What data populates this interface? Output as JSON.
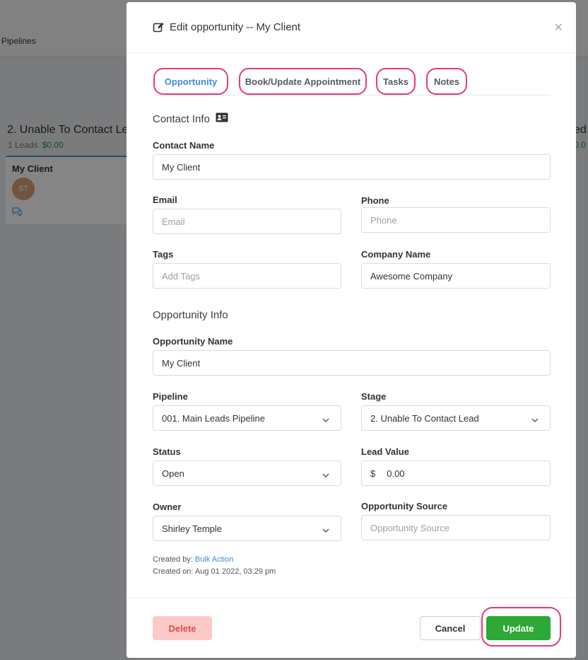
{
  "background": {
    "topbar_label": "Pipelines",
    "column_title": "2. Unable To Contact Le",
    "column_leads": "1 Leads",
    "column_amount": "$0.00",
    "card_name": "My Client",
    "card_avatar": "ST",
    "right_column_text": "ed",
    "right_column_sub": "0.0"
  },
  "modal": {
    "title": "Edit opportunity -- My Client",
    "title_icon": "edit-icon",
    "close_icon": "×",
    "tabs": [
      {
        "label": "Opportunity",
        "active": true
      },
      {
        "label": "Book/Update Appointment",
        "active": false
      },
      {
        "label": "Tasks",
        "active": false
      },
      {
        "label": "Notes",
        "active": false
      }
    ],
    "contact_info": {
      "section_title": "Contact Info",
      "contact_name_label": "Contact Name",
      "contact_name_value": "My Client",
      "email_label": "Email",
      "email_placeholder": "Email",
      "phone_label": "Phone",
      "phone_placeholder": "Phone",
      "tags_label": "Tags",
      "tags_placeholder": "Add Tags",
      "company_label": "Company Name",
      "company_value": "Awesome Company"
    },
    "opportunity_info": {
      "section_title": "Opportunity Info",
      "opportunity_name_label": "Opportunity Name",
      "opportunity_name_value": "My Client",
      "pipeline_label": "Pipeline",
      "pipeline_value": "001. Main Leads Pipeline",
      "stage_label": "Stage",
      "stage_value": "2. Unable To Contact Lead",
      "status_label": "Status",
      "status_value": "Open",
      "lead_value_label": "Lead Value",
      "lead_value_currency": "$",
      "lead_value_value": "0.00",
      "owner_label": "Owner",
      "owner_value": "Shirley Temple",
      "source_label": "Opportunity Source",
      "source_placeholder": "Opportunity Source"
    },
    "meta": {
      "created_by_label": "Created by: ",
      "created_by_value": "Bulk Action",
      "created_on": "Created on: Aug 01 2022, 03:29 pm"
    },
    "footer": {
      "delete_label": "Delete",
      "cancel_label": "Cancel",
      "update_label": "Update"
    }
  },
  "colors": {
    "accent_blue": "#3b8fd8",
    "highlight_pink": "#e03d7a",
    "update_green": "#2ea836",
    "delete_bg": "#fcc9c9",
    "delete_text": "#e04a4a"
  }
}
